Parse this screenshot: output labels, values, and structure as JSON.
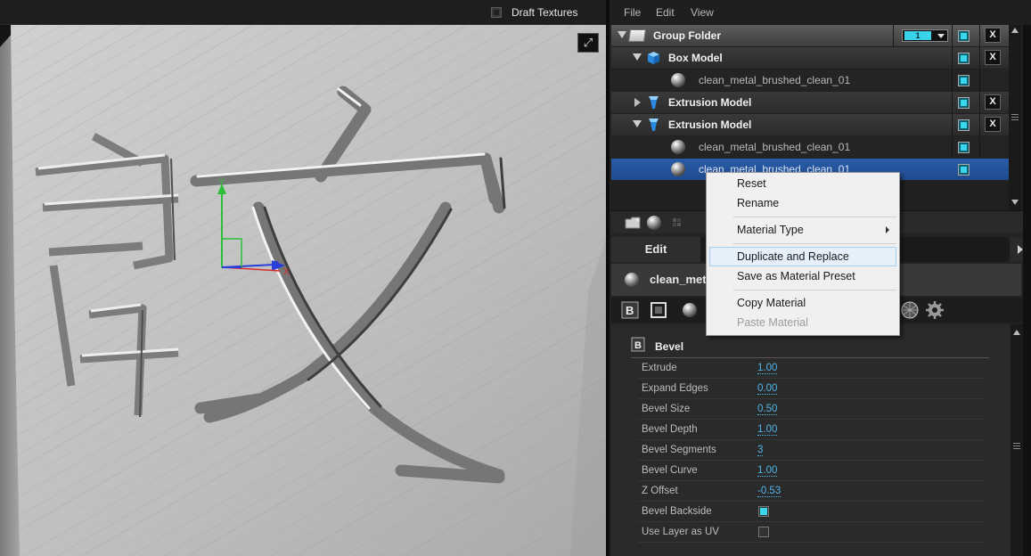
{
  "viewport": {
    "draft_textures_label": "Draft Textures",
    "maximize_icon": "expand-icon",
    "axes": {
      "y_label": "Y",
      "z_label": "Z",
      "x_label": "X"
    },
    "colors": {
      "y_axis": "#2bbf3a",
      "z_axis": "#2a3fd9",
      "x_axis": "#d92a2a",
      "metal": "#c8c8c8"
    }
  },
  "menubar": {
    "file": "File",
    "edit": "Edit",
    "view": "View"
  },
  "layers": [
    {
      "type": "group",
      "label": "Group Folder",
      "expanded": true,
      "layer_value": "1",
      "icon": "folder-icon"
    },
    {
      "type": "model",
      "label": "Box Model",
      "expanded": true,
      "icon": "cube-icon"
    },
    {
      "type": "material",
      "label": "clean_metal_brushed_clean_01",
      "icon": "material-sphere-icon"
    },
    {
      "type": "model",
      "label": "Extrusion Model",
      "expanded": false,
      "icon": "extrusion-icon"
    },
    {
      "type": "model",
      "label": "Extrusion Model",
      "expanded": true,
      "icon": "extrusion-icon"
    },
    {
      "type": "material",
      "label": "clean_metal_brushed_clean_01",
      "icon": "material-sphere-icon"
    },
    {
      "type": "material",
      "label": "clean_metal_brushed_clean_01",
      "icon": "material-sphere-icon",
      "selected": true
    }
  ],
  "layer_toolbar": [
    "new-folder-icon",
    "new-material-icon",
    "presets-icon"
  ],
  "close_label": "X",
  "edit_tab": {
    "label": "Edit"
  },
  "material_header": {
    "name": "clean_metal_brushed_clean_01"
  },
  "property_tabs": [
    "bevel-icon",
    "cap-icon",
    "material-icon",
    "environment-icon",
    "settings-icon"
  ],
  "bevel": {
    "title": "Bevel",
    "props": [
      {
        "name": "Extrude",
        "value": "1.00"
      },
      {
        "name": "Expand Edges",
        "value": "0.00"
      },
      {
        "name": "Bevel Size",
        "value": "0.50"
      },
      {
        "name": "Bevel Depth",
        "value": "1.00"
      },
      {
        "name": "Bevel Segments",
        "value": "3"
      },
      {
        "name": "Bevel Curve",
        "value": "1.00"
      },
      {
        "name": "Z Offset",
        "value": "-0.53"
      },
      {
        "name": "Bevel Backside",
        "checked": true
      },
      {
        "name": "Use Layer as UV",
        "checked": false
      }
    ]
  },
  "context_menu": {
    "items": [
      {
        "label": "Reset"
      },
      {
        "label": "Rename"
      },
      {
        "label": "Material Type",
        "submenu": true
      },
      {
        "label": "Duplicate and Replace",
        "hover": true
      },
      {
        "label": "Save as Material Preset"
      },
      {
        "label": "Copy Material"
      },
      {
        "label": "Paste Material",
        "disabled": true
      }
    ]
  }
}
